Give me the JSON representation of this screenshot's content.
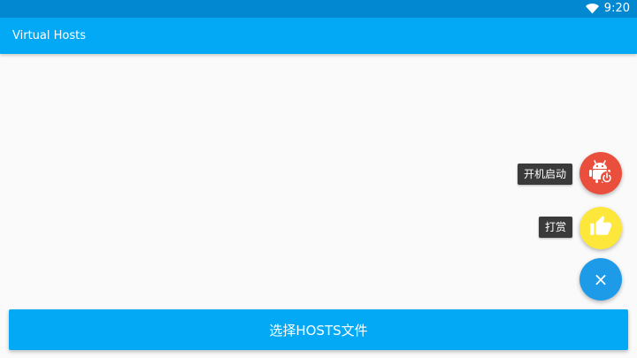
{
  "status_bar": {
    "time": "9:20",
    "icons": [
      "wifi-icon"
    ],
    "background": "#0288d1"
  },
  "app_bar": {
    "title": "Virtual Hosts",
    "background": "#03a9f4"
  },
  "fab_menu": {
    "items": [
      {
        "label": "开机启动",
        "icon": "android-power-icon",
        "color": "#ea4e3d"
      },
      {
        "label": "打赏",
        "icon": "thumbs-up-icon",
        "color": "#fde73a"
      }
    ],
    "main_icon": "close-icon",
    "main_glyph": "×",
    "main_color": "#1e9be8"
  },
  "bottom_button": {
    "label": "选择HOSTS文件",
    "color": "#03a9f4"
  }
}
